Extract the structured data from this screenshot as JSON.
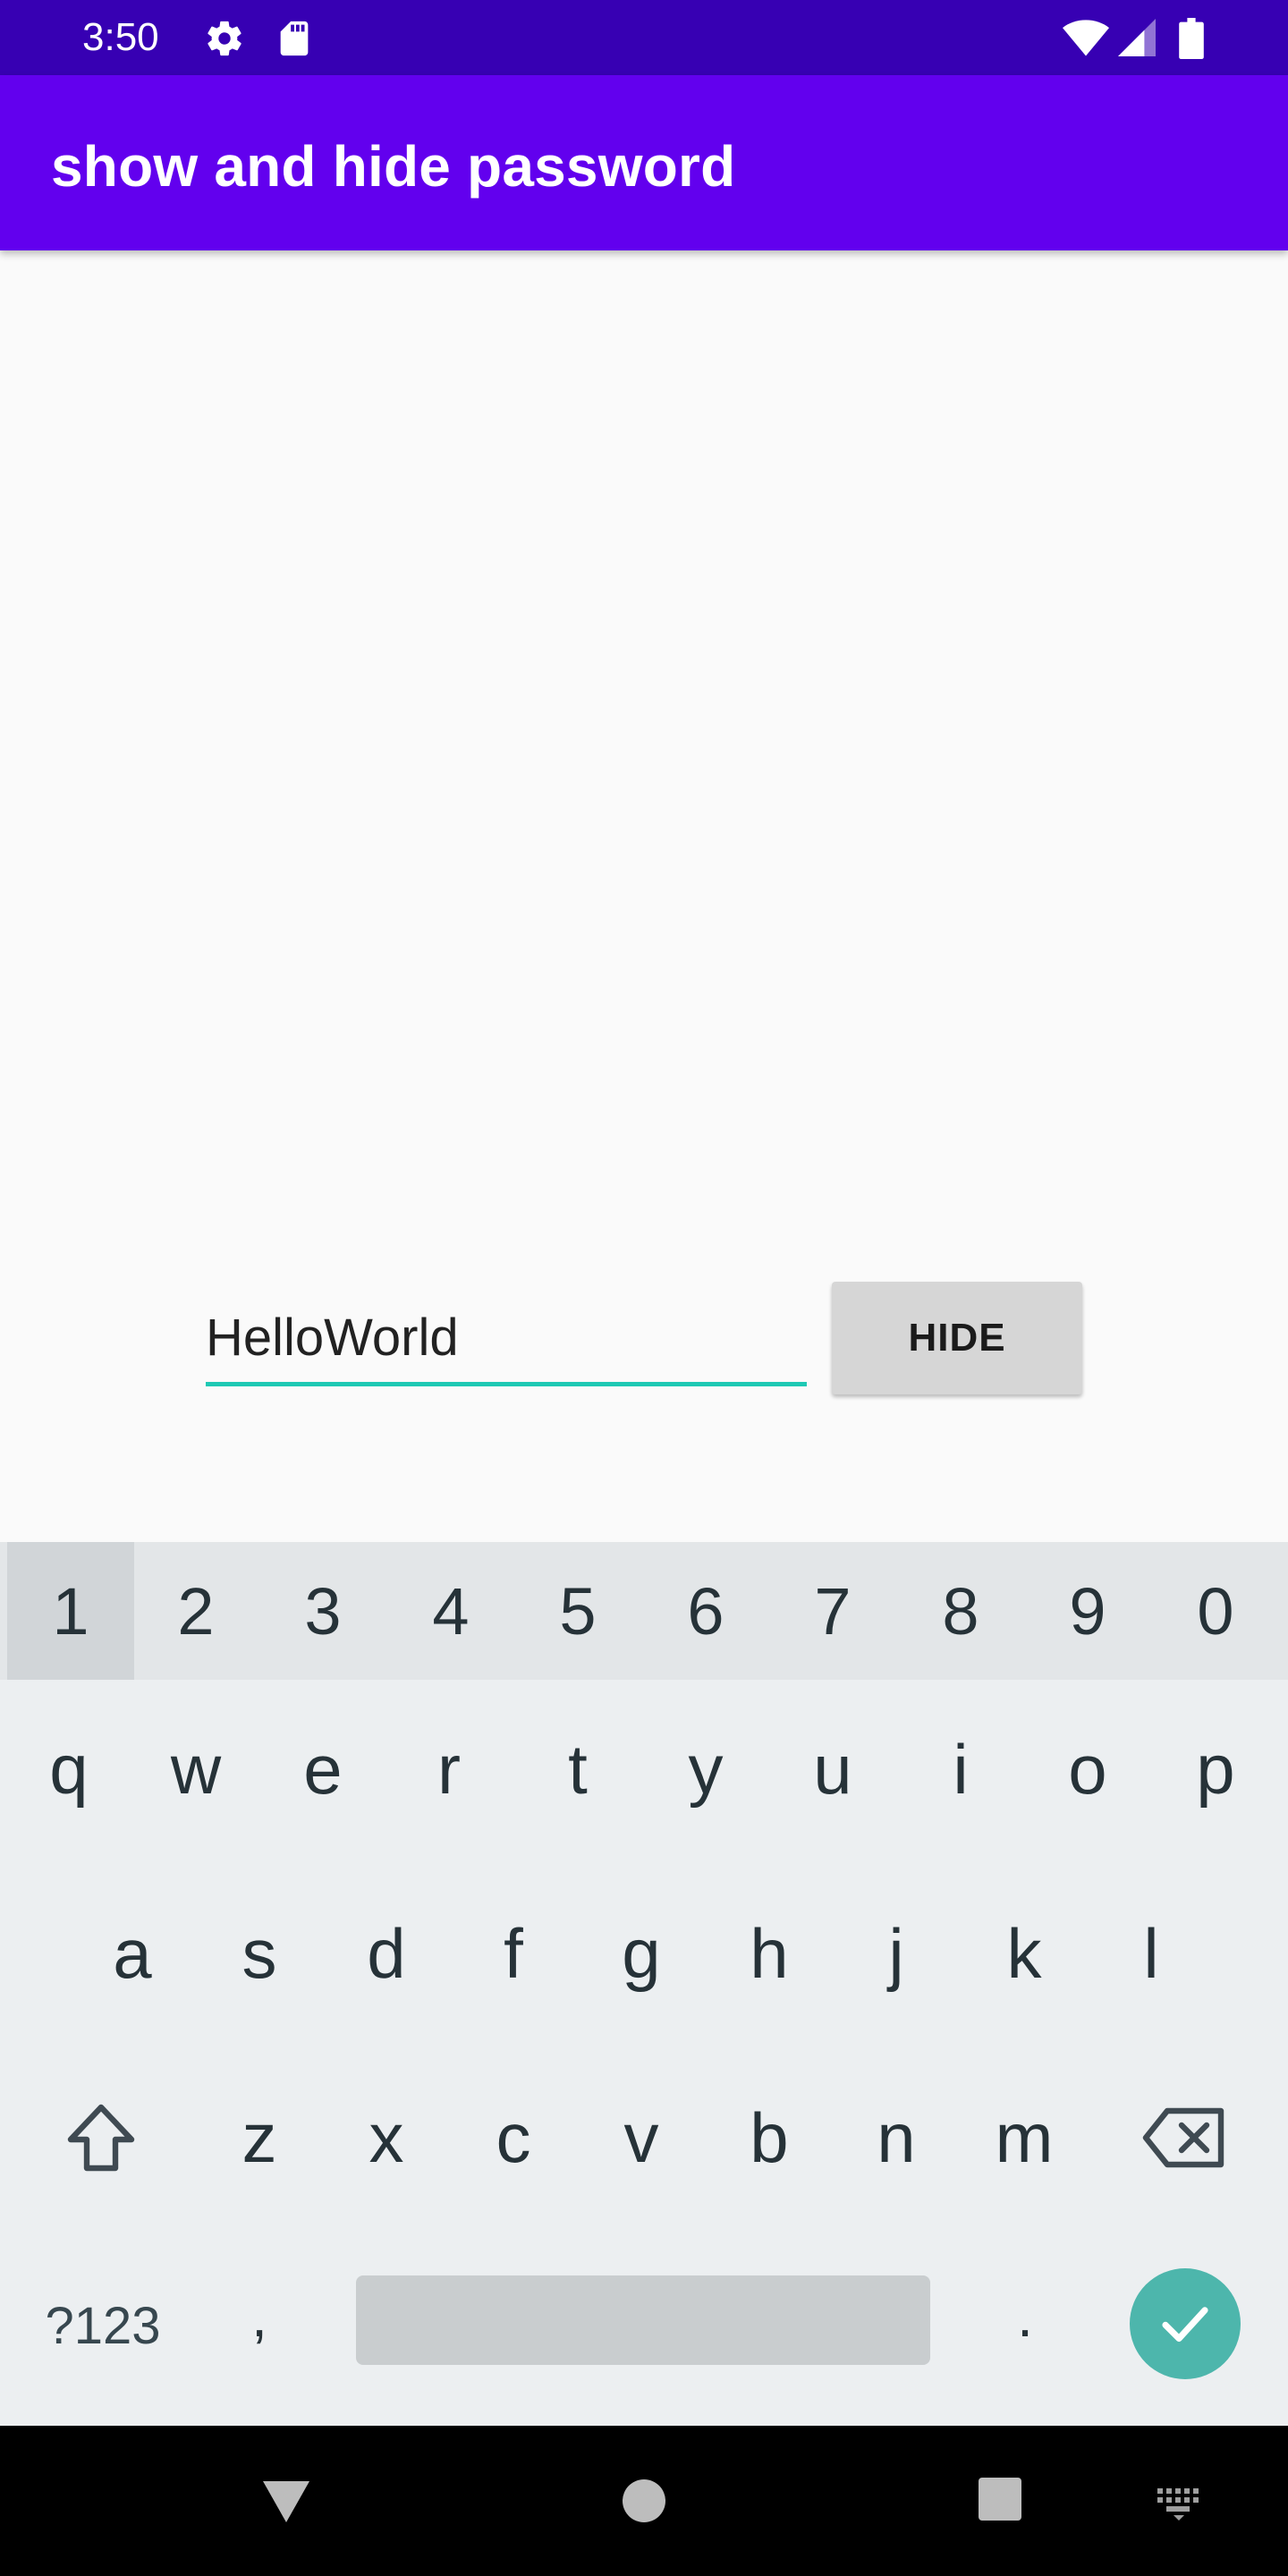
{
  "status_bar": {
    "time": "3:50",
    "icons": [
      "gear-icon",
      "sd-card-icon",
      "wifi-icon",
      "signal-icon",
      "battery-icon"
    ],
    "color": "#3700b3"
  },
  "app_bar": {
    "title": "show and hide password",
    "color": "#6200ee"
  },
  "password_field": {
    "value": "HelloWorld",
    "underline_color": "#1ec9b4"
  },
  "hide_button": {
    "label": "HIDE"
  },
  "keyboard": {
    "number_row": [
      "1",
      "2",
      "3",
      "4",
      "5",
      "6",
      "7",
      "8",
      "9",
      "0"
    ],
    "row1": [
      "q",
      "w",
      "e",
      "r",
      "t",
      "y",
      "u",
      "i",
      "o",
      "p"
    ],
    "row2": [
      "a",
      "s",
      "d",
      "f",
      "g",
      "h",
      "j",
      "k",
      "l"
    ],
    "row3": [
      "z",
      "x",
      "c",
      "v",
      "b",
      "n",
      "m"
    ],
    "symbols_key": "?123",
    "comma_key": ",",
    "period_key": ".",
    "enter_color": "#4db6ac"
  },
  "nav_bar": {
    "icons": [
      "back-icon",
      "home-icon",
      "recents-icon",
      "keyboard-switch-icon"
    ]
  }
}
